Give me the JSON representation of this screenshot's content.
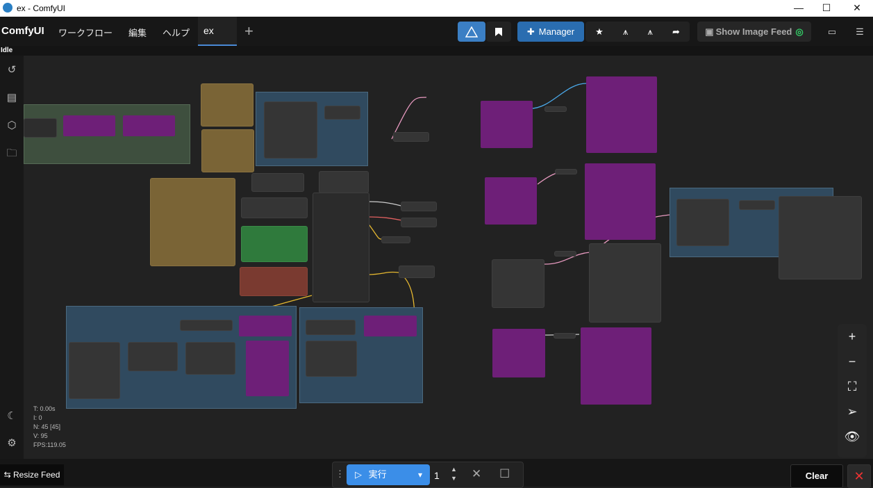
{
  "window": {
    "title": "ex - ComfyUI",
    "minimize": "—",
    "maximize": "☐",
    "close": "✕"
  },
  "menubar": {
    "brand": "ComfyUI",
    "items": [
      "ワークフロー",
      "編集",
      "ヘルプ"
    ],
    "tab_label": "ex",
    "add_tab": "+",
    "manager_label": "Manager",
    "show_image_feed": "Show Image Feed"
  },
  "status": "Idle",
  "stats": {
    "t": "T: 0.00s",
    "i": "I: 0",
    "n": "N: 45 [45]",
    "v": "V: 95",
    "fps": "FPS:119.05"
  },
  "bottombar": {
    "resize_feed": "Resize Feed",
    "run_label": "実行",
    "queue_count": "1",
    "clear_label": "Clear"
  },
  "colors": {
    "accent": "#3b8ee8",
    "node_purple": "#6e1f78",
    "group_blue": "#304a5f",
    "group_green": "#3e4f3e"
  }
}
